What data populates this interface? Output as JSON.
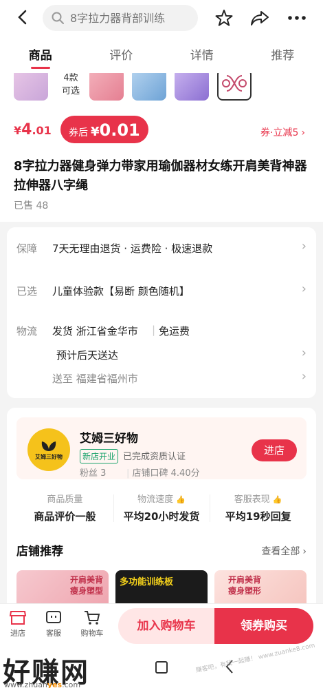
{
  "header": {
    "search_placeholder": "8字拉力器背部训练"
  },
  "tabs": [
    {
      "label": "商品"
    },
    {
      "label": "评价"
    },
    {
      "label": "详情"
    },
    {
      "label": "推荐"
    }
  ],
  "gallery": {
    "styles_count": "4款",
    "styles_sub": "可选"
  },
  "price": {
    "symbol": "¥",
    "integer": "4",
    "decimal": ".01",
    "after_label": "券后",
    "after_symbol": "¥",
    "after_value": "0.01",
    "coupon": "券·立减5"
  },
  "product": {
    "title": "8字拉力器健身弹力带家用瑜伽器材女练开肩美背神器拉伸器八字绳",
    "sold": "已售 48"
  },
  "service": {
    "guarantee_label": "保障",
    "guarantee_value": "7天无理由退货 · 运费险 · 极速退款",
    "selected_label": "已选",
    "selected_value": "儿童体验款【易断 颜色随机】",
    "shipping_label": "物流",
    "ship_from": "发货 浙江省金华市",
    "ship_fee": "免运费",
    "eta": "预计后天送达",
    "deliver_to": "送至 福建省福州市"
  },
  "shop": {
    "logo_text": "艾姆三好物",
    "name": "艾姆三好物",
    "new_tag": "新店开业",
    "cert": "已完成资质认证",
    "fans": "粉丝 3",
    "rating": "店铺口碑 4.40分",
    "enter_label": "进店",
    "metrics": [
      {
        "head": "商品质量",
        "value": "商品评价一般"
      },
      {
        "head": "物流速度",
        "value": "平均20小时发货"
      },
      {
        "head": "客服表现",
        "value": "平均19秒回复"
      }
    ],
    "reco_title": "店铺推荐",
    "see_all": "查看全部",
    "reco_items": [
      {
        "text": "开肩美背 瘦身塑型"
      },
      {
        "text": "多功能训练板"
      },
      {
        "text": "开肩美背 瘦身塑形"
      }
    ]
  },
  "bottom": {
    "store_label": "进店",
    "service_label": "客服",
    "cart_label": "购物车",
    "add_cart": "加入购物车",
    "buy": "领券购买"
  },
  "watermark": {
    "brand": "好赚网",
    "url_pre": "www.zhuan",
    "url_mid": "yes",
    "url_post": ".com",
    "right_text": "赚客吧，有我一起赚！ www.zuanke8.com"
  },
  "colors": {
    "accent": "#e8334a",
    "shop_logo": "#f5c21b",
    "new_tag": "#1aa36b"
  }
}
